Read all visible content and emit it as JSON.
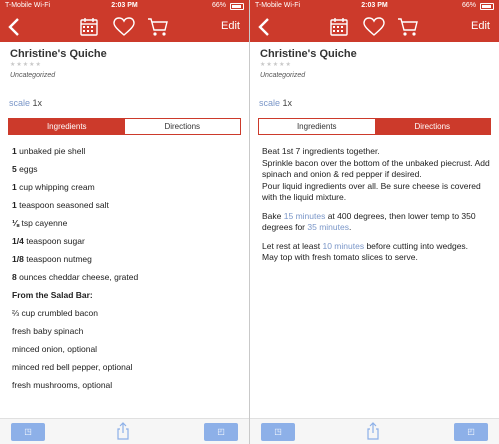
{
  "status": {
    "carrier": "T-Mobile Wi-Fi",
    "time": "2:03 PM",
    "battery": "66%"
  },
  "nav": {
    "edit_label": "Edit"
  },
  "recipe": {
    "title": "Christine's Quiche",
    "stars": "★★★★★",
    "category": "Uncategorized",
    "scale_label": "scale",
    "scale_value": "1x"
  },
  "tabs": {
    "ingredients": "Ingredients",
    "directions": "Directions"
  },
  "ingredients": [
    {
      "qty": "1",
      "text": "unbaked pie shell"
    },
    {
      "qty": "5",
      "text": "eggs"
    },
    {
      "qty": "1",
      "text": "cup whipping cream"
    },
    {
      "qty": "1",
      "text": "teaspoon seasoned salt"
    },
    {
      "qty": "⅛",
      "text": "tsp cayenne"
    },
    {
      "qty": "1/4",
      "text": "teaspoon sugar"
    },
    {
      "qty": "1/8",
      "text": "teaspoon nutmeg"
    },
    {
      "qty": "8",
      "text": "ounces cheddar cheese, grated"
    },
    {
      "section": "From the Salad Bar:"
    },
    {
      "qty": "",
      "text": "⅔ cup crumbled bacon"
    },
    {
      "qty": "",
      "text": "fresh baby spinach"
    },
    {
      "qty": "",
      "text": "minced onion, optional"
    },
    {
      "qty": "",
      "text": "minced red bell pepper, optional"
    },
    {
      "qty": "",
      "text": "fresh mushrooms, optional"
    }
  ],
  "directions": {
    "p1_line1": "Beat 1st 7 ingredients together.",
    "p1_line2": "Sprinkle bacon over the bottom of the unbaked piecrust. Add spinach and onion & red pepper if desired.",
    "p1_line3": "Pour liquid ingredients over all. Be sure cheese is covered with the liquid mixture.",
    "p2_a": "Bake ",
    "p2_timer1": "15 minutes",
    "p2_b": " at 400 degrees, then lower temp to 350 degrees for ",
    "p2_timer2": "35 minutes",
    "p2_c": ".",
    "p3_a": "Let rest at least ",
    "p3_timer": "10 minutes",
    "p3_b": " before cutting into wedges.",
    "p3_line2": "May top with fresh tomato slices to serve."
  },
  "colors": {
    "accent": "#cc3a2b",
    "link": "#7a96c8",
    "toolbar_button": "#8db0e8"
  },
  "icons": [
    "back-icon",
    "calendar-icon",
    "heart-icon",
    "cart-icon",
    "share-icon"
  ]
}
